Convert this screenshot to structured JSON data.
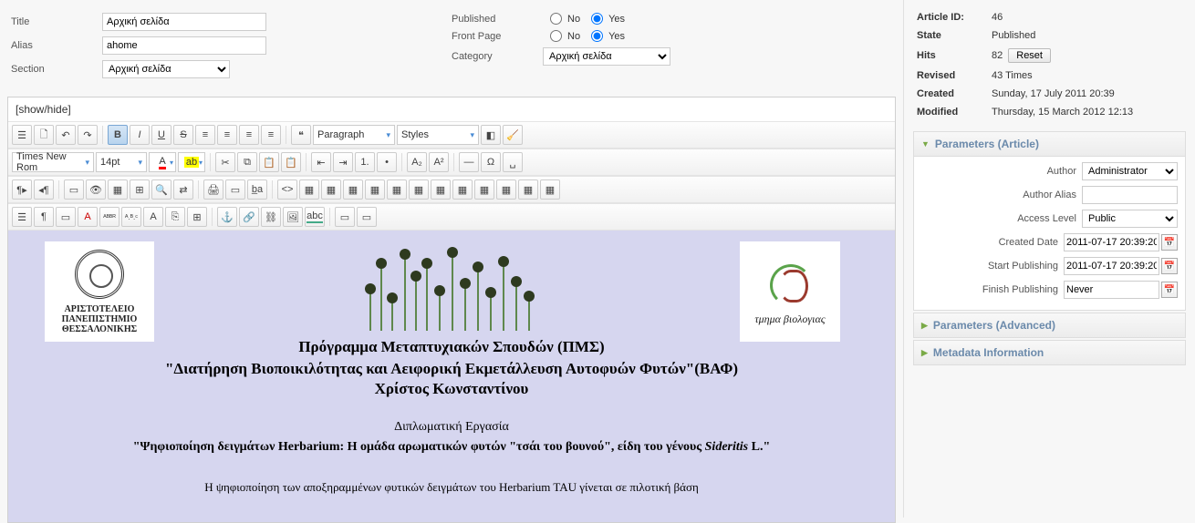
{
  "form": {
    "title_label": "Title",
    "title_value": "Αρχική σελίδα",
    "alias_label": "Alias",
    "alias_value": "ahome",
    "section_label": "Section",
    "section_value": "Αρχική σελίδα",
    "published_label": "Published",
    "frontpage_label": "Front Page",
    "category_label": "Category",
    "category_value": "Αρχική σελίδα",
    "no": "No",
    "yes": "Yes"
  },
  "showhide": "[show/hide]",
  "editor": {
    "paragraph": "Paragraph",
    "styles": "Styles",
    "font": "Times New Rom",
    "size": "14pt"
  },
  "content": {
    "uni1": "ΑΡΙΣΤΟΤΕΛΕΙΟ",
    "uni2": "ΠΑΝΕΠΙΣΤΗΜΙΟ",
    "uni3": "ΘΕΣΣΑΛΟΝΙΚΗΣ",
    "dept": "τμημα βιολογιας",
    "line1": "Πρόγραμμα Μεταπτυχιακών  Σπουδών (ΠΜΣ)",
    "line2": "\"Διατήρηση Βιοποικιλότητας και Αειφορική Εκμετάλλευση Αυτοφυών Φυτών\"(ΒΑΦ)",
    "line3": "Χρίστος Κωνσταντίνου",
    "line4": "Διπλωματική Εργασία",
    "line5a": "\"Ψηφιοποίηση δειγμάτων Herbarium: Η ομάδα αρωματικών φυτών \"τσάι του βουνού\", είδη του γένους ",
    "line5b": "Sideritis",
    "line5c": " L.\"",
    "line6": "Η ψηφιοποίηση των αποξηραμμένων φυτικών δειγμάτων του Herbarium TAU γίνεται σε πιλοτική βάση"
  },
  "info": {
    "article_id_label": "Article ID:",
    "article_id": "46",
    "state_label": "State",
    "state": "Published",
    "hits_label": "Hits",
    "hits": "82",
    "reset": "Reset",
    "revised_label": "Revised",
    "revised": "43 Times",
    "created_label": "Created",
    "created": "Sunday, 17 July 2011 20:39",
    "modified_label": "Modified",
    "modified": "Thursday, 15 March 2012 12:13"
  },
  "params": {
    "article_header": "Parameters (Article)",
    "author_label": "Author",
    "author_value": "Administrator",
    "author_alias_label": "Author Alias",
    "author_alias_value": "",
    "access_label": "Access Level",
    "access_value": "Public",
    "created_date_label": "Created Date",
    "created_date_value": "2011-07-17 20:39:20",
    "start_pub_label": "Start Publishing",
    "start_pub_value": "2011-07-17 20:39:20",
    "finish_pub_label": "Finish Publishing",
    "finish_pub_value": "Never",
    "advanced_header": "Parameters (Advanced)",
    "metadata_header": "Metadata Information"
  }
}
